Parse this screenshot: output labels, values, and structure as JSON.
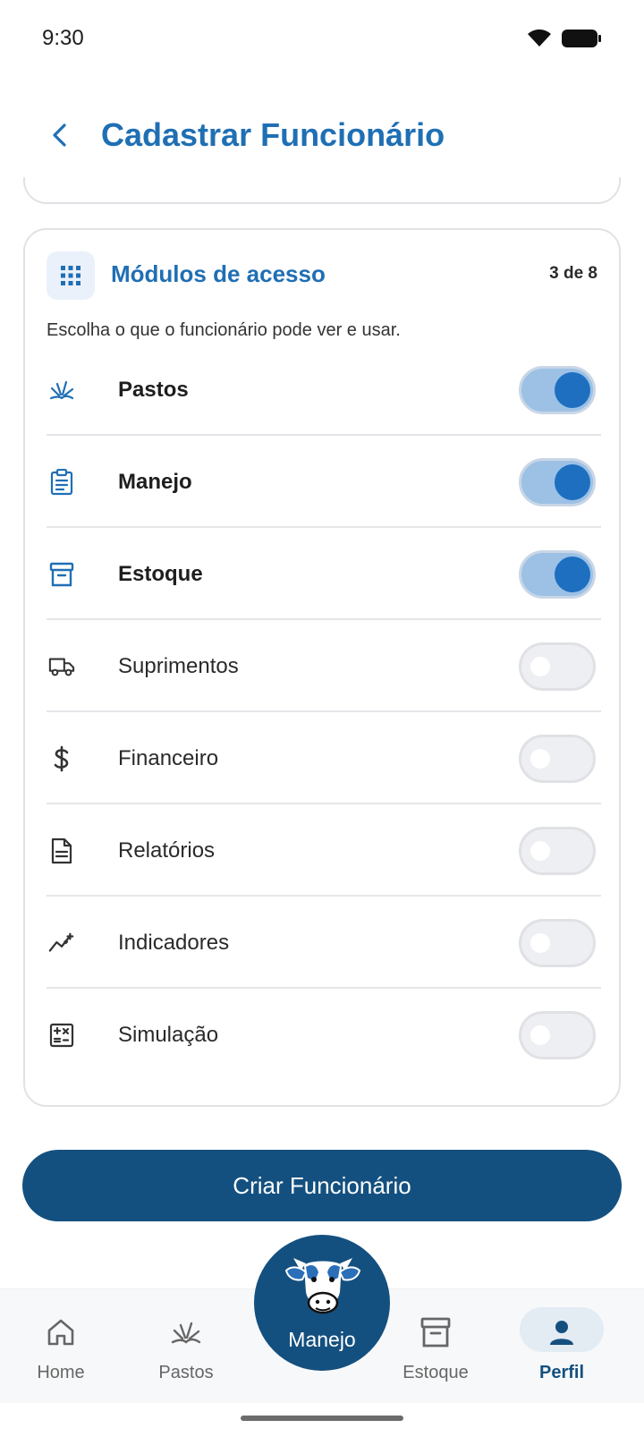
{
  "status_bar": {
    "time": "9:30"
  },
  "header": {
    "title": "Cadastrar Funcionário"
  },
  "modules_card": {
    "title": "Módulos de acesso",
    "count": "3 de 8",
    "subtitle": "Escolha o que o funcionário pode ver e usar.",
    "items": [
      {
        "label": "Pastos",
        "icon": "grass-icon",
        "enabled": true
      },
      {
        "label": "Manejo",
        "icon": "clipboard-icon",
        "enabled": true
      },
      {
        "label": "Estoque",
        "icon": "archive-box-icon",
        "enabled": true
      },
      {
        "label": "Suprimentos",
        "icon": "truck-icon",
        "enabled": false
      },
      {
        "label": "Financeiro",
        "icon": "dollar-icon",
        "enabled": false
      },
      {
        "label": "Relatórios",
        "icon": "document-icon",
        "enabled": false
      },
      {
        "label": "Indicadores",
        "icon": "trend-chart-icon",
        "enabled": false
      },
      {
        "label": "Simulação",
        "icon": "calculator-icon",
        "enabled": false
      }
    ]
  },
  "primary_action": {
    "label": "Criar Funcionário"
  },
  "bottom_nav": {
    "items": [
      {
        "label": "Home",
        "icon": "home-icon",
        "active": false
      },
      {
        "label": "Pastos",
        "icon": "grass-icon",
        "active": false
      },
      {
        "label": "Manejo",
        "icon": "cow-icon",
        "active": false
      },
      {
        "label": "Estoque",
        "icon": "archive-box-icon",
        "active": false
      },
      {
        "label": "Perfil",
        "icon": "person-icon",
        "active": true
      }
    ]
  },
  "colors": {
    "accent": "#1f6fb4",
    "primary_dark": "#14507f",
    "toggle_on_track": "#9cc1e5",
    "toggle_on_knob": "#1e6fc0"
  }
}
